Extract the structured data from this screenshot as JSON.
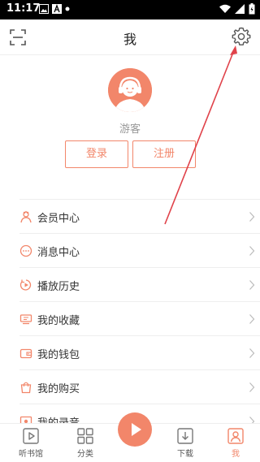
{
  "status_bar": {
    "time": "11:17"
  },
  "header": {
    "title": "我",
    "scan_icon": "scan-icon",
    "settings_icon": "gear-icon"
  },
  "profile": {
    "name": "游客",
    "login_label": "登录",
    "register_label": "注册"
  },
  "menu": {
    "items": [
      {
        "label": "会员中心",
        "icon": "vip-icon"
      },
      {
        "label": "消息中心",
        "icon": "message-icon"
      },
      {
        "label": "播放历史",
        "icon": "history-icon"
      },
      {
        "label": "我的收藏",
        "icon": "favorites-icon"
      },
      {
        "label": "我的钱包",
        "icon": "wallet-icon"
      },
      {
        "label": "我的购买",
        "icon": "purchase-icon"
      },
      {
        "label": "我的录音",
        "icon": "recording-icon"
      }
    ]
  },
  "bottom_nav": {
    "items": [
      {
        "label": "听书馆",
        "icon": "library-icon"
      },
      {
        "label": "分类",
        "icon": "category-icon"
      },
      {
        "label": "下载",
        "icon": "download-icon"
      },
      {
        "label": "我",
        "icon": "user-icon",
        "active": true
      }
    ],
    "play_icon": "play-icon"
  },
  "colors": {
    "accent": "#f2866a",
    "annotation": "#e0424a"
  }
}
